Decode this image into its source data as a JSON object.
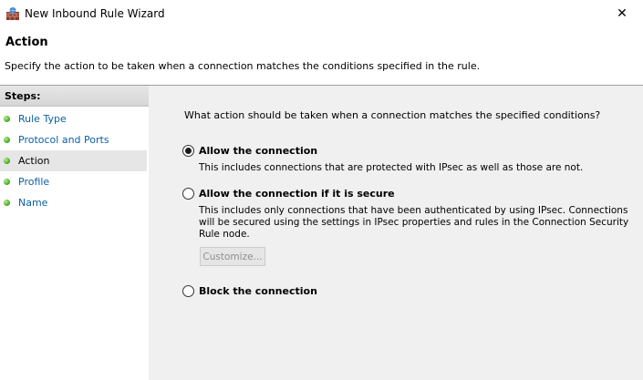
{
  "window": {
    "title": "New Inbound Rule Wizard",
    "close_glyph": "✕"
  },
  "header": {
    "title": "Action",
    "description": "Specify the action to be taken when a connection matches the conditions specified in the rule."
  },
  "steps": {
    "header": "Steps:",
    "items": [
      {
        "label": "Rule Type",
        "active": false
      },
      {
        "label": "Protocol and Ports",
        "active": false
      },
      {
        "label": "Action",
        "active": true
      },
      {
        "label": "Profile",
        "active": false
      },
      {
        "label": "Name",
        "active": false
      }
    ]
  },
  "main": {
    "question": "What action should be taken when a connection matches the specified conditions?",
    "options": [
      {
        "label": "Allow the connection",
        "checked": true,
        "description": "This includes connections that are protected with IPsec as well as those are not."
      },
      {
        "label": "Allow the connection if it is secure",
        "checked": false,
        "description_lines": [
          "This includes only connections that have been authenticated by using IPsec.  Connections",
          "will be secured using the settings in IPsec properties and rules in the Connection Security",
          "Rule node."
        ]
      },
      {
        "label": "Block the connection",
        "checked": false
      }
    ],
    "customize_label": "Customize...",
    "customize_enabled": false
  },
  "colors": {
    "step_link": "#0b5fa5",
    "step_dot": "#3ea21b",
    "pane_bg": "#f0f0f0"
  }
}
